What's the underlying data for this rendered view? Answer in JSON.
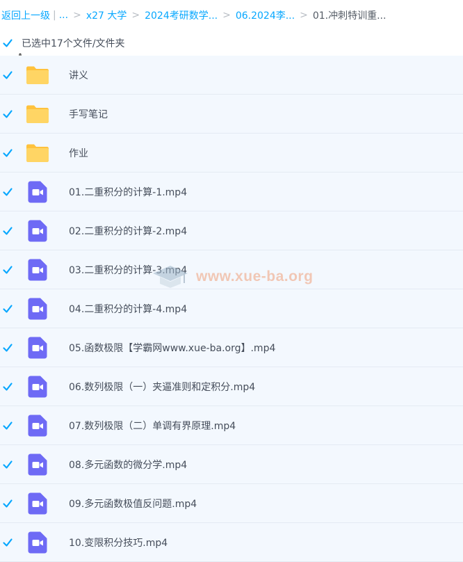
{
  "breadcrumb": {
    "back_label": "返回上一级",
    "separator": "|",
    "ellipsis": "...",
    "items": [
      "x27 大学",
      "2024考研数学...",
      "06.2024李...",
      "01.冲刺特训重..."
    ]
  },
  "selection": {
    "label": "已选中17个文件/文件夹",
    "checked": true
  },
  "colors": {
    "accent": "#06a7ff",
    "folder": "#ffd15c",
    "video_icon": "#6e6af5",
    "row_selected_bg": "#f3f8fe"
  },
  "files": [
    {
      "name": "讲义",
      "type": "folder",
      "icon": "folder-icon"
    },
    {
      "name": "手写笔记",
      "type": "folder",
      "icon": "folder-icon"
    },
    {
      "name": "作业",
      "type": "folder",
      "icon": "folder-icon"
    },
    {
      "name": "01.二重积分的计算-1.mp4",
      "type": "video",
      "icon": "video-file-icon"
    },
    {
      "name": "02.二重积分的计算-2.mp4",
      "type": "video",
      "icon": "video-file-icon"
    },
    {
      "name": "03.二重积分的计算-3.mp4",
      "type": "video",
      "icon": "video-file-icon"
    },
    {
      "name": "04.二重积分的计算-4.mp4",
      "type": "video",
      "icon": "video-file-icon"
    },
    {
      "name": "05.函数极限【学霸网www.xue-ba.org】.mp4",
      "type": "video",
      "icon": "video-file-icon"
    },
    {
      "name": "06.数列极限（一）夹逼准则和定积分.mp4",
      "type": "video",
      "icon": "video-file-icon"
    },
    {
      "name": "07.数列极限（二）单调有界原理.mp4",
      "type": "video",
      "icon": "video-file-icon"
    },
    {
      "name": "08.多元函数的微分学.mp4",
      "type": "video",
      "icon": "video-file-icon"
    },
    {
      "name": "09.多元函数极值反问题.mp4",
      "type": "video",
      "icon": "video-file-icon"
    },
    {
      "name": "10.变限积分技巧.mp4",
      "type": "video",
      "icon": "video-file-icon"
    }
  ],
  "watermark": {
    "text": "www.xue-ba.org",
    "icon": "graduation-cap-icon"
  }
}
